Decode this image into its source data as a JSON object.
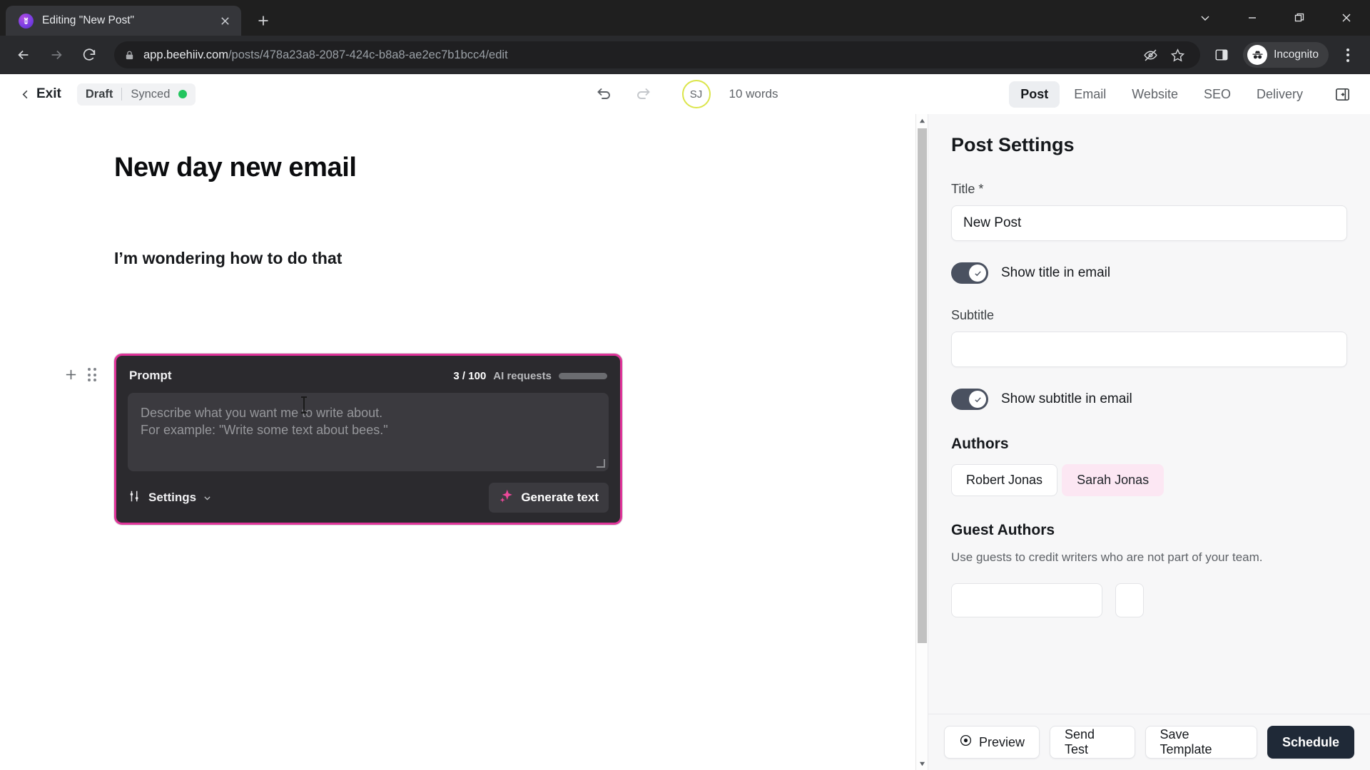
{
  "browser": {
    "tab": {
      "title": "Editing \"New Post\"",
      "favicon_icon": "beehiiv-bee-icon",
      "close_icon": "close-icon"
    },
    "new_tab_icon": "plus-icon",
    "window_controls": [
      "chevron-down-icon",
      "minimize-icon",
      "maximize-icon",
      "close-icon"
    ],
    "nav": {
      "back_icon": "arrow-left-icon",
      "forward_icon": "arrow-right-icon",
      "reload_icon": "reload-icon"
    },
    "omnibox": {
      "lock_icon": "lock-icon",
      "url_domain": "app.beehiiv.com",
      "url_path": "/posts/478a23a8-2087-424c-b8a8-ae2ec7b1bcc4/edit",
      "tracking_icon": "eye-slash-icon",
      "bookmark_icon": "star-icon"
    },
    "side_panel_icon": "side-panel-icon",
    "profile": {
      "label": "Incognito",
      "icon": "incognito-icon"
    },
    "menu_icon": "three-dots-vertical-icon"
  },
  "app_header": {
    "exit": {
      "label": "Exit",
      "icon": "chevron-left-icon"
    },
    "status": {
      "draft": "Draft",
      "sync": "Synced",
      "dot_color": "#22c55e"
    },
    "undo_icon": "undo-icon",
    "redo_icon": "redo-icon",
    "avatar": {
      "initials": "SJ",
      "ring_color": "#dbe54a"
    },
    "word_count": "10 words",
    "tabs": [
      {
        "label": "Post",
        "active": true
      },
      {
        "label": "Email",
        "active": false
      },
      {
        "label": "Website",
        "active": false
      },
      {
        "label": "SEO",
        "active": false
      },
      {
        "label": "Delivery",
        "active": false
      }
    ],
    "collapse_icon": "panel-collapse-icon"
  },
  "editor": {
    "title": "New day new email",
    "paragraph": "I’m wondering how to do that",
    "add_block_icon": "plus-icon",
    "drag_handle_icon": "drag-grip-icon",
    "ai_block": {
      "label": "Prompt",
      "requests_count": "3 / 100",
      "requests_label": "AI requests",
      "progress_percent": 3,
      "accent_color": "#e0349a",
      "placeholder_line1": "Describe what you want me to write about.",
      "placeholder_line2": "For example: \"Write some text about bees.\"",
      "settings_label": "Settings",
      "settings_icon": "sliders-icon",
      "settings_chevron_icon": "chevron-down-icon",
      "generate_label": "Generate text",
      "generate_icon": "sparkle-icon"
    }
  },
  "panel": {
    "title": "Post Settings",
    "title_field": {
      "label": "Title *",
      "value": "New Post"
    },
    "show_title_toggle": {
      "label": "Show title in email",
      "on": true
    },
    "subtitle_field": {
      "label": "Subtitle",
      "value": ""
    },
    "show_subtitle_toggle": {
      "label": "Show subtitle in email",
      "on": true
    },
    "authors": {
      "heading": "Authors",
      "chips": [
        "Robert Jonas",
        "Sarah Jonas"
      ]
    },
    "guest_authors": {
      "heading": "Guest Authors",
      "description": "Use guests to credit writers who are not part of your team."
    },
    "footer_buttons": [
      {
        "label": "Preview",
        "icon": "eye-icon",
        "primary": false
      },
      {
        "label": "Send Test",
        "icon": "",
        "primary": false
      },
      {
        "label": "Save Template",
        "icon": "",
        "primary": false
      },
      {
        "label": "Schedule",
        "icon": "",
        "primary": true
      }
    ]
  }
}
